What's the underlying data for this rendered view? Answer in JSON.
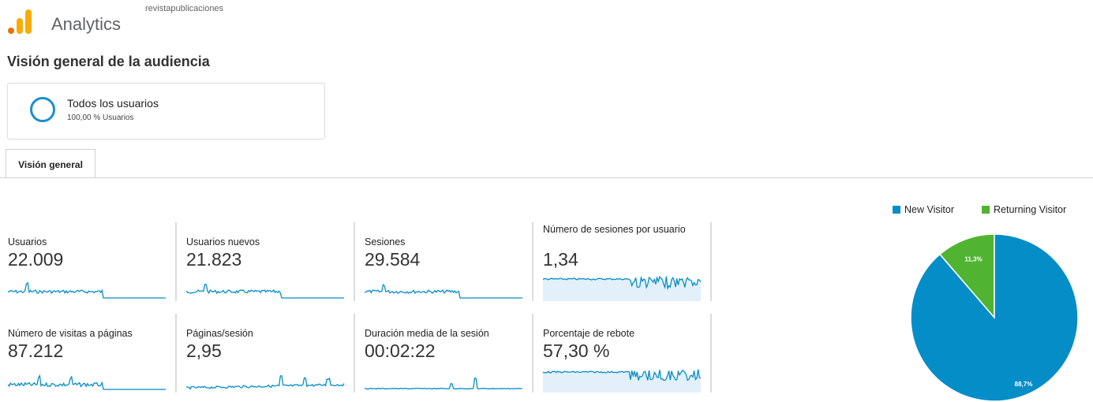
{
  "header": {
    "app_name": "Analytics",
    "account": "revistapublicaciones"
  },
  "page_title": "Visión general de la audiencia",
  "segment": {
    "name": "Todos los usuarios",
    "percentage": "100,00 % Usuarios"
  },
  "tabs": [
    {
      "label": "Visión general",
      "active": true
    }
  ],
  "metrics": [
    {
      "label": "Usuarios",
      "value": "22.009"
    },
    {
      "label": "Usuarios nuevos",
      "value": "21.823"
    },
    {
      "label": "Sesiones",
      "value": "29.584"
    },
    {
      "label": "Número de sesiones por usuario",
      "value": "1,34"
    },
    {
      "label": "Número de visitas a páginas",
      "value": "87.212"
    },
    {
      "label": "Páginas/sesión",
      "value": "2,95"
    },
    {
      "label": "Duración media de la sesión",
      "value": "00:02:22"
    },
    {
      "label": "Porcentaje de rebote",
      "value": "57,30 %"
    }
  ],
  "colors": {
    "primary": "#058dc7",
    "secondary": "#50b432",
    "segment_ring": "#1a8fd0",
    "logo_orange": "#f9ab00",
    "logo_dark_orange": "#e37400"
  },
  "chart_data": {
    "type": "pie",
    "legend_position": "top-right",
    "slices": [
      {
        "label": "New Visitor",
        "value": 88.7,
        "value_label": "88,7%",
        "color": "#058dc7"
      },
      {
        "label": "Returning Visitor",
        "value": 11.3,
        "value_label": "11,3%",
        "color": "#50b432"
      }
    ]
  }
}
